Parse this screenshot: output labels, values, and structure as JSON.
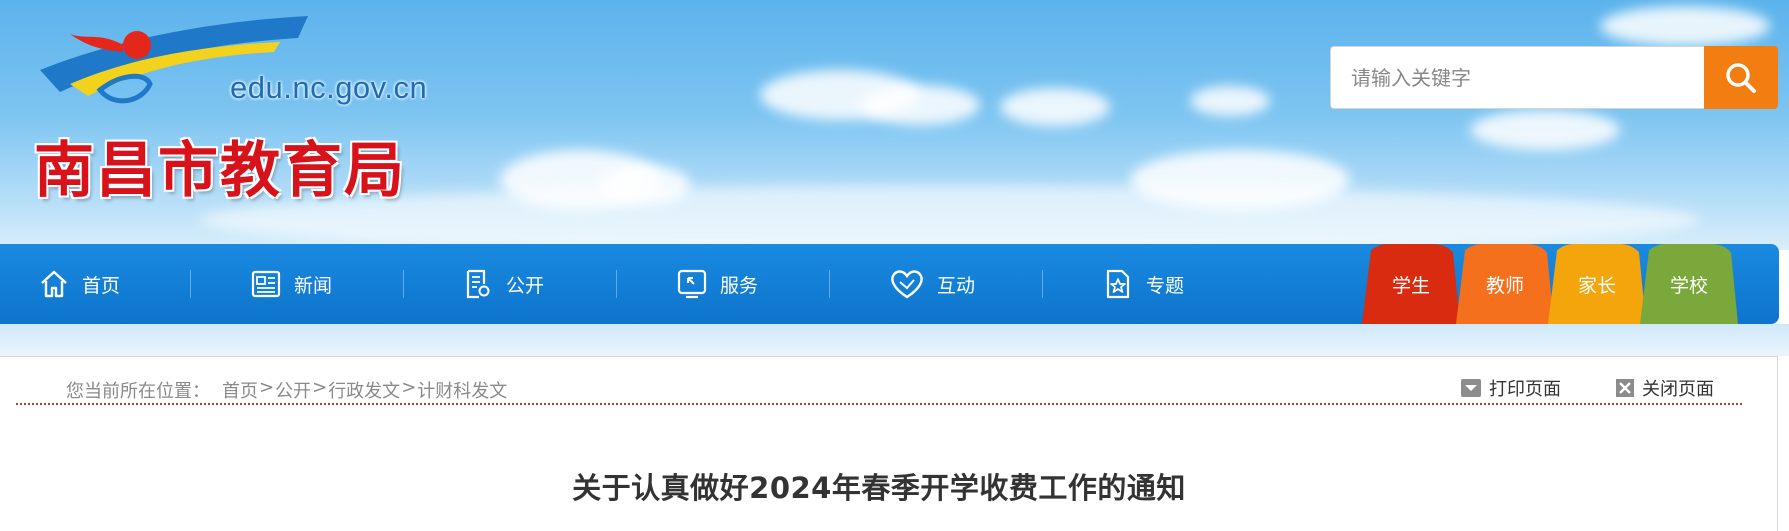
{
  "header": {
    "logo_domain": "edu.nc.gov.cn",
    "logo_name": "南昌市教育局"
  },
  "search": {
    "placeholder": "请输入关键字",
    "button_icon": "search-icon",
    "button_color": "#f27d10"
  },
  "nav": {
    "items": [
      {
        "label": "首页",
        "icon": "home-icon"
      },
      {
        "label": "新闻",
        "icon": "newspaper-icon"
      },
      {
        "label": "公开",
        "icon": "document-icon"
      },
      {
        "label": "服务",
        "icon": "service-icon"
      },
      {
        "label": "互动",
        "icon": "heart-icon"
      },
      {
        "label": "专题",
        "icon": "star-document-icon"
      }
    ],
    "roles": [
      {
        "label": "学生",
        "color": "#d92b0f"
      },
      {
        "label": "教师",
        "color": "#f5701c"
      },
      {
        "label": "家长",
        "color": "#f5a50c"
      },
      {
        "label": "学校",
        "color": "#7aa83a"
      }
    ],
    "bar_color": "#0d74cc"
  },
  "breadcrumb": {
    "prefix": "您当前所在位置：",
    "items": [
      "首页",
      "公开",
      "行政发文",
      "计财科发文"
    ],
    "separator": ">"
  },
  "tools": {
    "print": "打印页面",
    "close": "关闭页面"
  },
  "article": {
    "title": "关于认真做好2024年春季开学收费工作的通知"
  }
}
